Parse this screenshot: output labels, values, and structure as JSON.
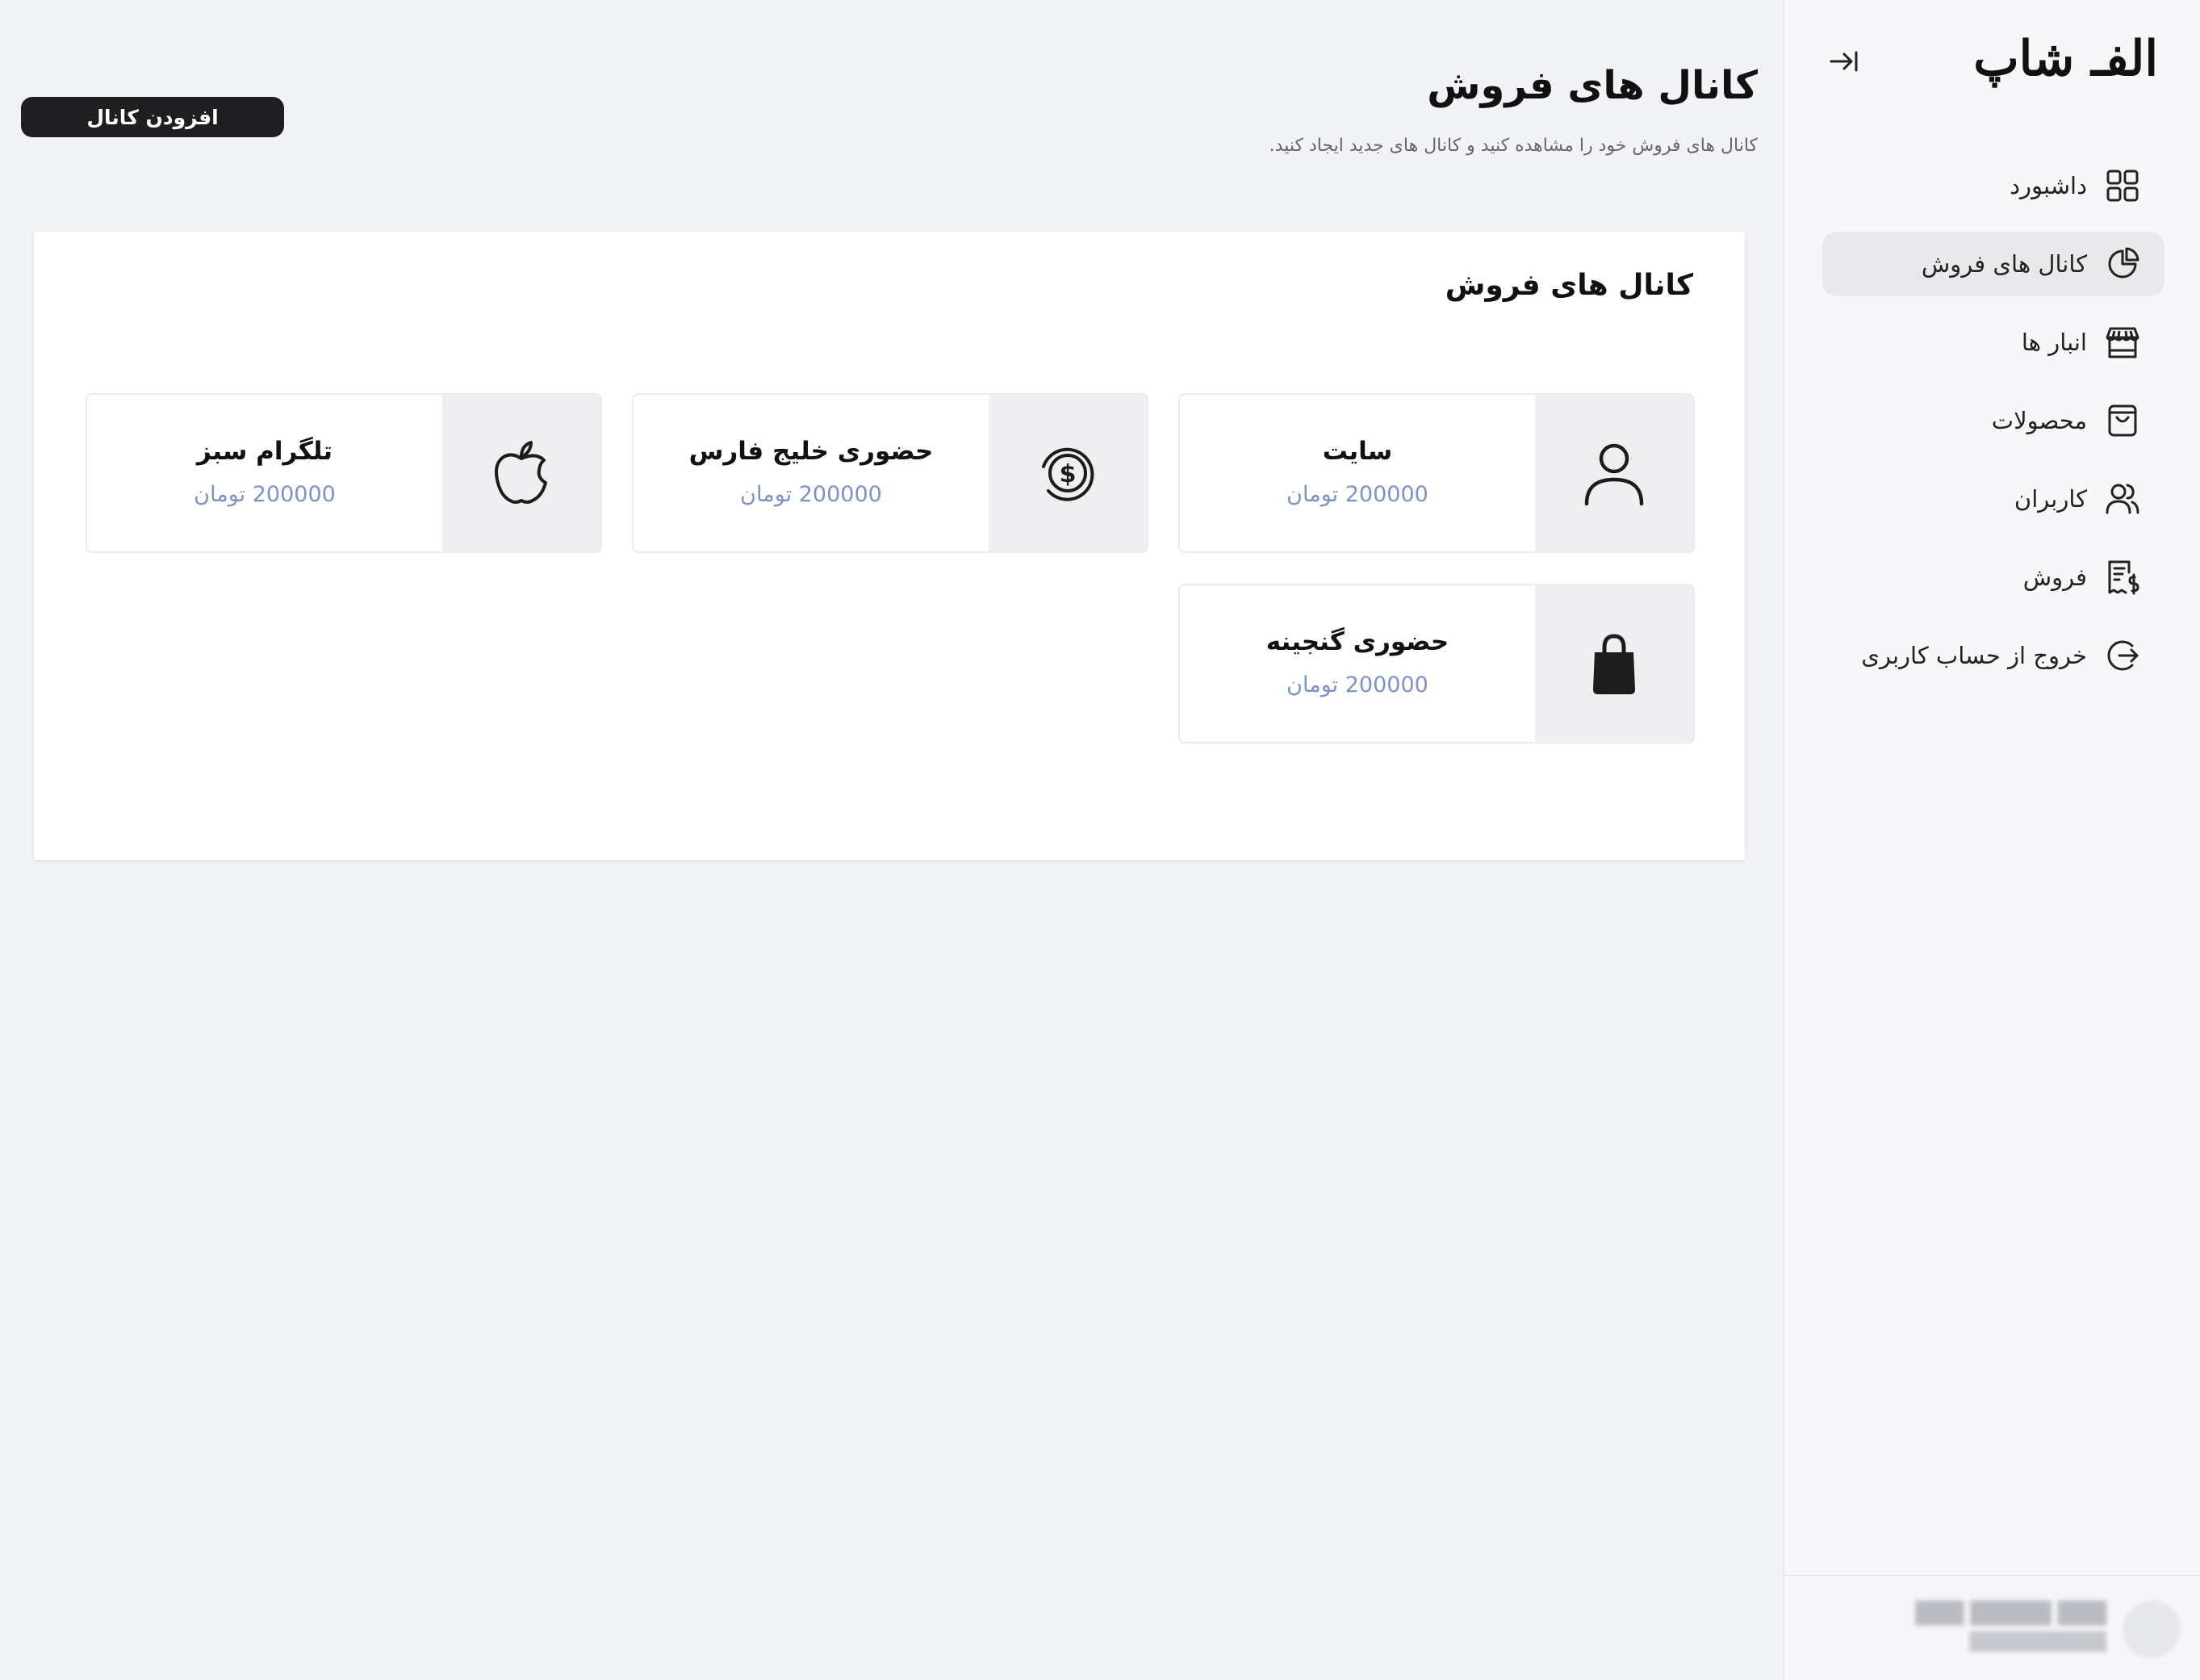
{
  "sidebar": {
    "logo": "الفـ شاپ",
    "nav": [
      {
        "label": "داشبورد",
        "icon": "grid-icon",
        "active": false
      },
      {
        "label": "کانال های فروش",
        "icon": "pie-chart-icon",
        "active": true
      },
      {
        "label": "انبار ها",
        "icon": "store-icon",
        "active": false
      },
      {
        "label": "محصولات",
        "icon": "shopping-bag-icon",
        "active": false
      },
      {
        "label": "کاربران",
        "icon": "users-icon",
        "active": false
      },
      {
        "label": "فروش",
        "icon": "receipt-icon",
        "active": false
      },
      {
        "label": "خروج از حساب کاربری",
        "icon": "logout-icon",
        "active": false
      }
    ]
  },
  "header": {
    "title": "کانال های فروش",
    "subtitle": "کانال های فروش خود را مشاهده کنید و کانال های جدید ایجاد کنید.",
    "add_button": "افزودن کانال"
  },
  "panel": {
    "title": "کانال های فروش",
    "channels": [
      {
        "name": "سایت",
        "price": "200000 تومان",
        "icon": "user-icon"
      },
      {
        "name": "حضوری خلیج فارس",
        "price": "200000 تومان",
        "icon": "dollar-coin-icon"
      },
      {
        "name": "تلگرام سبز",
        "price": "200000 تومان",
        "icon": "apple-icon"
      },
      {
        "name": "حضوری گنجینه",
        "price": "200000 تومان",
        "icon": "bag-icon"
      }
    ]
  },
  "colors": {
    "background": "#f2f3f7",
    "sidebar": "#f7f7f9",
    "active_item": "#e9e9ec",
    "button": "#1f1f21",
    "price": "#7d92c6"
  }
}
